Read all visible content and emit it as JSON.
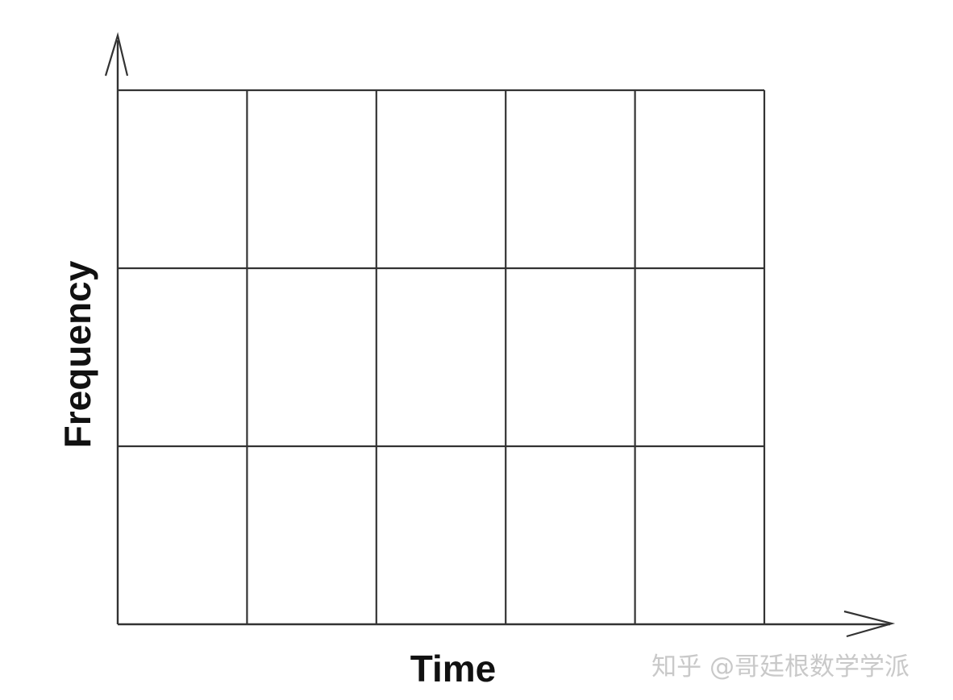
{
  "diagram": {
    "x_axis_label": "Time",
    "y_axis_label": "Frequency",
    "grid": {
      "columns": 5,
      "rows": 3
    },
    "line_color": "#333333"
  },
  "watermark": {
    "text": "知乎 @哥廷根数学学派"
  }
}
